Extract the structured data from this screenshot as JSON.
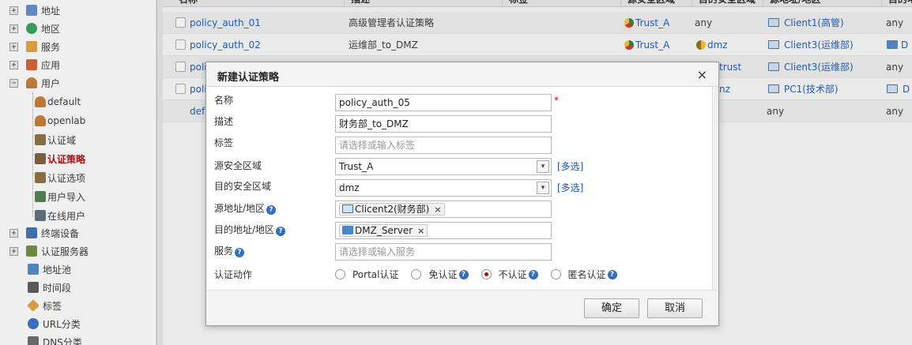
{
  "sidebar": {
    "items": [
      {
        "label": "地址",
        "expand": "+",
        "color": "#5b8bd0"
      },
      {
        "label": "地区",
        "expand": "+",
        "color": "#2e9e5b"
      },
      {
        "label": "服务",
        "expand": "+",
        "color": "#e2a23a"
      },
      {
        "label": "应用",
        "expand": "+",
        "color": "#d95b2a"
      },
      {
        "label": "用户",
        "expand": "−",
        "color": "#c77a2e"
      }
    ],
    "user_children": [
      {
        "label": "default"
      },
      {
        "label": "openlab"
      },
      {
        "label": "认证域"
      },
      {
        "label": "认证策略"
      },
      {
        "label": "认证选项"
      },
      {
        "label": "用户导入"
      },
      {
        "label": "在线用户"
      }
    ],
    "bottom_items": [
      {
        "label": "终端设备",
        "expand": "+",
        "color": "#3a6fb0"
      },
      {
        "label": "认证服务器",
        "expand": "+",
        "color": "#6b8a3a"
      },
      {
        "label": "地址池",
        "expand": "",
        "color": "#4a86c8"
      },
      {
        "label": "时间段",
        "expand": "",
        "color": "#555"
      },
      {
        "label": "标签",
        "expand": "",
        "color": "#e2a23a"
      },
      {
        "label": "URL分类",
        "expand": "",
        "color": "#2f6fc6"
      },
      {
        "label": "DNS分类",
        "expand": "",
        "color": "#666"
      }
    ]
  },
  "table": {
    "headers": [
      "名称",
      "描述",
      "标签",
      "源安全区域",
      "目的安全区域",
      "源地址/地区",
      "目的地"
    ],
    "rows": [
      {
        "name": "policy_auth_01",
        "desc": "高级管理者认证策略",
        "src_zone": "Trust_A",
        "dst_zone": "any",
        "src_addr": "Client1(高管)",
        "dst_addr": "any"
      },
      {
        "name": "policy_auth_02",
        "desc": "运维部_to_DMZ",
        "src_zone": "Trust_A",
        "dst_zone": "dmz",
        "src_addr": "Client3(运维部)",
        "dst_addr": "D"
      },
      {
        "name": "poli",
        "desc": "",
        "src_zone": "",
        "dst_zone": "trust",
        "src_addr": "Client3(运维部)",
        "dst_addr": "any"
      },
      {
        "name": "poli",
        "desc": "",
        "src_zone": "",
        "dst_zone": "nz",
        "src_addr": "PC1(技术部)",
        "dst_addr": "D"
      },
      {
        "name": "defa",
        "desc": "",
        "src_zone": "",
        "dst_zone": "",
        "src_addr": "any",
        "dst_addr": "any"
      }
    ]
  },
  "dialog": {
    "title": "新建认证策略",
    "close": "×",
    "fields": {
      "name_label": "名称",
      "name_value": "policy_auth_05",
      "required_mark": "*",
      "desc_label": "描述",
      "desc_value": "财务部_to_DMZ",
      "tag_label": "标签",
      "tag_placeholder": "请选择或输入标签",
      "src_zone_label": "源安全区域",
      "src_zone_value": "Trust_A",
      "dst_zone_label": "目的安全区域",
      "dst_zone_value": "dmz",
      "multi_label": "[多选]",
      "src_addr_label": "源地址/地区",
      "src_addr_tag": "Clicent2(财务部)",
      "dst_addr_label": "目的地址/地区",
      "dst_addr_tag": "DMZ_Server",
      "service_label": "服务",
      "service_placeholder": "请选择或输入服务",
      "action_label": "认证动作",
      "actions": [
        {
          "label": "Portal认证",
          "selected": false,
          "help": false
        },
        {
          "label": "免认证",
          "selected": false,
          "help": true
        },
        {
          "label": "不认证",
          "selected": true,
          "help": true
        },
        {
          "label": "匿名认证",
          "selected": false,
          "help": true
        }
      ],
      "help_glyph": "?",
      "tag_remove": "×",
      "select_arrow": "▾"
    },
    "buttons": {
      "ok": "确定",
      "cancel": "取消"
    }
  }
}
